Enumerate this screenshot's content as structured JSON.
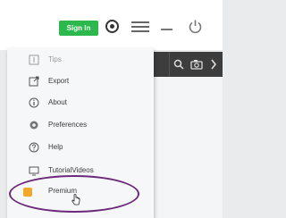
{
  "topbar": {
    "signin_label": "Sign In"
  },
  "menu": {
    "items": [
      {
        "label": "Tips",
        "icon": "tips-icon"
      },
      {
        "label": "Export",
        "icon": "export-icon"
      },
      {
        "label": "About",
        "icon": "info-icon"
      },
      {
        "label": "Preferences",
        "icon": "gear-icon"
      },
      {
        "label": "Help",
        "icon": "help-icon"
      },
      {
        "label": "TutorialVideos",
        "icon": "video-icon"
      },
      {
        "label": "Premium",
        "icon": "premium-icon"
      }
    ]
  },
  "colors": {
    "signin_bg": "#2db84d",
    "premium_accent": "#f1a82a",
    "highlight_ring": "#6b2a7a",
    "toolbar_dark": "#3d3d3d"
  }
}
